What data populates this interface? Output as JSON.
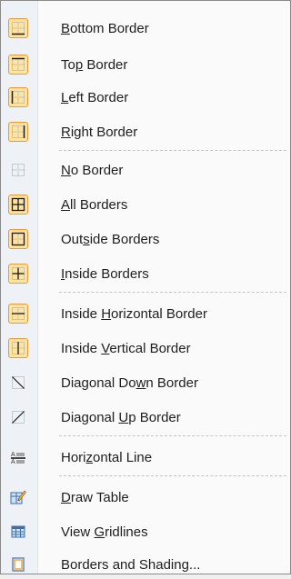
{
  "menu": {
    "items": [
      {
        "label": "Bottom Border",
        "accel": "B",
        "icon": "bottom-border-icon",
        "checked": true
      },
      {
        "label": "Top Border",
        "accel": "p",
        "icon": "top-border-icon",
        "checked": true
      },
      {
        "label": "Left Border",
        "accel": "L",
        "icon": "left-border-icon",
        "checked": true
      },
      {
        "label": "Right Border",
        "accel": "R",
        "icon": "right-border-icon",
        "checked": true
      },
      {
        "label": "No Border",
        "accel": "N",
        "icon": "no-border-icon",
        "checked": false
      },
      {
        "label": "All Borders",
        "accel": "A",
        "icon": "all-borders-icon",
        "checked": true
      },
      {
        "label": "Outside Borders",
        "accel": "s",
        "icon": "outside-borders-icon",
        "checked": true
      },
      {
        "label": "Inside Borders",
        "accel": "I",
        "icon": "inside-borders-icon",
        "checked": true
      },
      {
        "label": "Inside Horizontal Border",
        "accel": "H",
        "icon": "inside-horizontal-border-icon",
        "checked": true
      },
      {
        "label": "Inside Vertical Border",
        "accel": "V",
        "icon": "inside-vertical-border-icon",
        "checked": true
      },
      {
        "label": "Diagonal Down Border",
        "accel": "w",
        "icon": "diagonal-down-border-icon",
        "checked": false
      },
      {
        "label": "Diagonal Up Border",
        "accel": "U",
        "icon": "diagonal-up-border-icon",
        "checked": false
      },
      {
        "label": "Horizontal Line",
        "accel": "z",
        "icon": "horizontal-line-icon",
        "checked": false
      },
      {
        "label": "Draw Table",
        "accel": "D",
        "icon": "draw-table-icon",
        "checked": false
      },
      {
        "label": "View Gridlines",
        "accel": "G",
        "icon": "view-gridlines-icon",
        "checked": false
      },
      {
        "label": "Borders and Shading...",
        "accel": "O",
        "icon": "borders-and-shading-icon",
        "checked": false
      }
    ]
  },
  "colors": {
    "checked_fill": "#ffe3a0",
    "checked_border": "#e99b36",
    "icon_line": "#1a1a1a",
    "icon_dotted": "#9aa4b0"
  }
}
